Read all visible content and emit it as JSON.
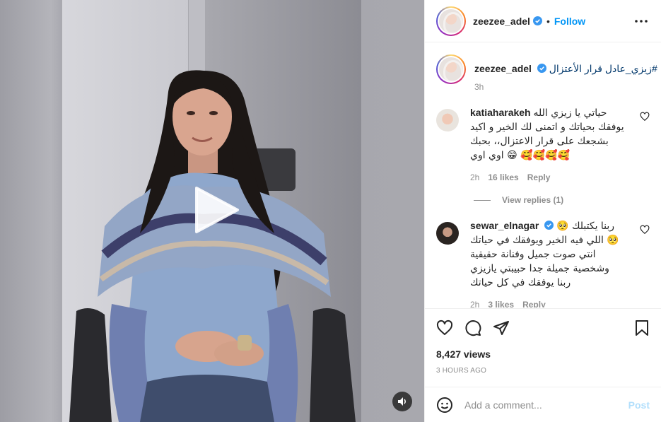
{
  "post": {
    "username": "zeezee_adel",
    "follow_label": "Follow",
    "dot": "•",
    "caption": {
      "username": "zeezee_adel",
      "text": "زيزي_عادل قرار الأعتزال#",
      "time": "3h"
    }
  },
  "comments": [
    {
      "username": "katiaharakeh",
      "text": "حياتي يا زيزي الله يوفقك بحياتك و اتمنى لك الخير و اكيد بشجعك على قرار الاعتزال،، بحبك اوي اوي 😁 🥰🥰🥰🥰",
      "time": "2h",
      "likes": "16 likes",
      "reply_label": "Reply",
      "view_replies": "View replies (1)"
    },
    {
      "username": "sewar_elnagar",
      "text": "ربنا يكتبلك 🥺🥺 اللي فيه الخير ويوفقك في حياتك انتي صوت جميل وفنانة حقيقية وشخصية جميلة جدا حبيبتي يازيزي ربنا يوفقك في كل حياتك",
      "time": "2h",
      "likes": "3 likes",
      "reply_label": "Reply"
    }
  ],
  "stats": {
    "views": "8,427 views",
    "time_ago": "3 HOURS AGO"
  },
  "comment_box": {
    "placeholder": "Add a comment...",
    "post_label": "Post"
  },
  "icons": {
    "more": "more-options-icon",
    "like": "heart-icon",
    "comment": "comment-icon",
    "share": "share-icon",
    "save": "bookmark-icon",
    "emoji": "emoji-icon",
    "play": "play-icon",
    "mute": "speaker-icon"
  },
  "colors": {
    "accent": "#0095f6",
    "verified": "#3897f0",
    "muted_text": "#8e8e8e",
    "hashtag": "#00376b",
    "post_disabled": "#b2dffc"
  }
}
